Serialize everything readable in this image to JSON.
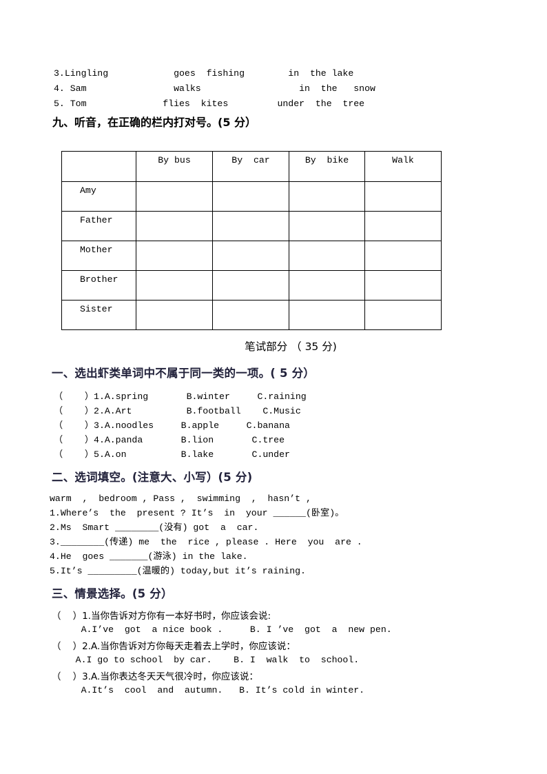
{
  "document": {
    "listening_tail_items": [
      "3.Lingling            goes  fishing        in  the lake",
      "4. Sam                walks                  in  the   snow",
      "5. Tom              flies  kites         under  the  tree"
    ],
    "section_nine": {
      "heading": "九、听音，在正确的栏内打对号。(5 分）",
      "table": {
        "columns": [
          "",
          "By bus",
          "By  car",
          "By  bike",
          "Walk"
        ],
        "rows": [
          {
            "label": "Amy",
            "cells": [
              "",
              "",
              "",
              ""
            ]
          },
          {
            "label": "Father",
            "cells": [
              "",
              "",
              "",
              ""
            ]
          },
          {
            "label": "Mother",
            "cells": [
              "",
              "",
              "",
              ""
            ]
          },
          {
            "label": "Brother",
            "cells": [
              "",
              "",
              "",
              ""
            ]
          },
          {
            "label": "Sister",
            "cells": [
              "",
              "",
              "",
              ""
            ]
          }
        ]
      }
    },
    "written_part_title": "笔试部分 （ 35 分)",
    "section_one": {
      "heading": "一、选出虾类单词中不属于同一类的一项。( 5 分）",
      "items": [
        "（    ）1.A.spring       B.winter     C.raining",
        "（    ）2.A.Art          B.football    C.Music",
        "（    ）3.A.noodles     B.apple     C.banana",
        "（    ）4.A.panda       B.lion       C.tree",
        "（    ）5.A.on          B.lake       C.under"
      ]
    },
    "section_two": {
      "heading": "二、选词填空。(注意大、小写）(5 分)",
      "word_bank": "warm  ,  bedroom , Pass ,  swimming  ,  hasn’t ,",
      "items": [
        "1.Where’s  the  present ? It’s  in  your ______(卧室)。",
        "2.Ms  Smart ________(没有) got  a  car.",
        "3.________(传递) me  the  rice , please . Here  you  are .",
        "4.He  goes _______(游泳) in the lake.",
        "5.It’s _________(温暖的) today,but it’s raining."
      ]
    },
    "section_three": {
      "heading": "三、情景选择。(5 分）",
      "items": [
        {
          "prompt": "（    ）1.当你告诉对方你有一本好书时，你应该会说:",
          "options": "     A.I’ve  got  a nice book .     B. I ’ve  got  a  new pen."
        },
        {
          "prompt": "（    ）2.A.当你告诉对方你每天走着去上学时，你应该说：",
          "options": "    A.I go to school  by car.    B. I  walk  to  school."
        },
        {
          "prompt": "（    ）3.A.当你表达冬天天气很冷时，你应该说：",
          "options": "     A.It’s  cool  and  autumn.   B. It’s cold in winter."
        }
      ]
    }
  }
}
